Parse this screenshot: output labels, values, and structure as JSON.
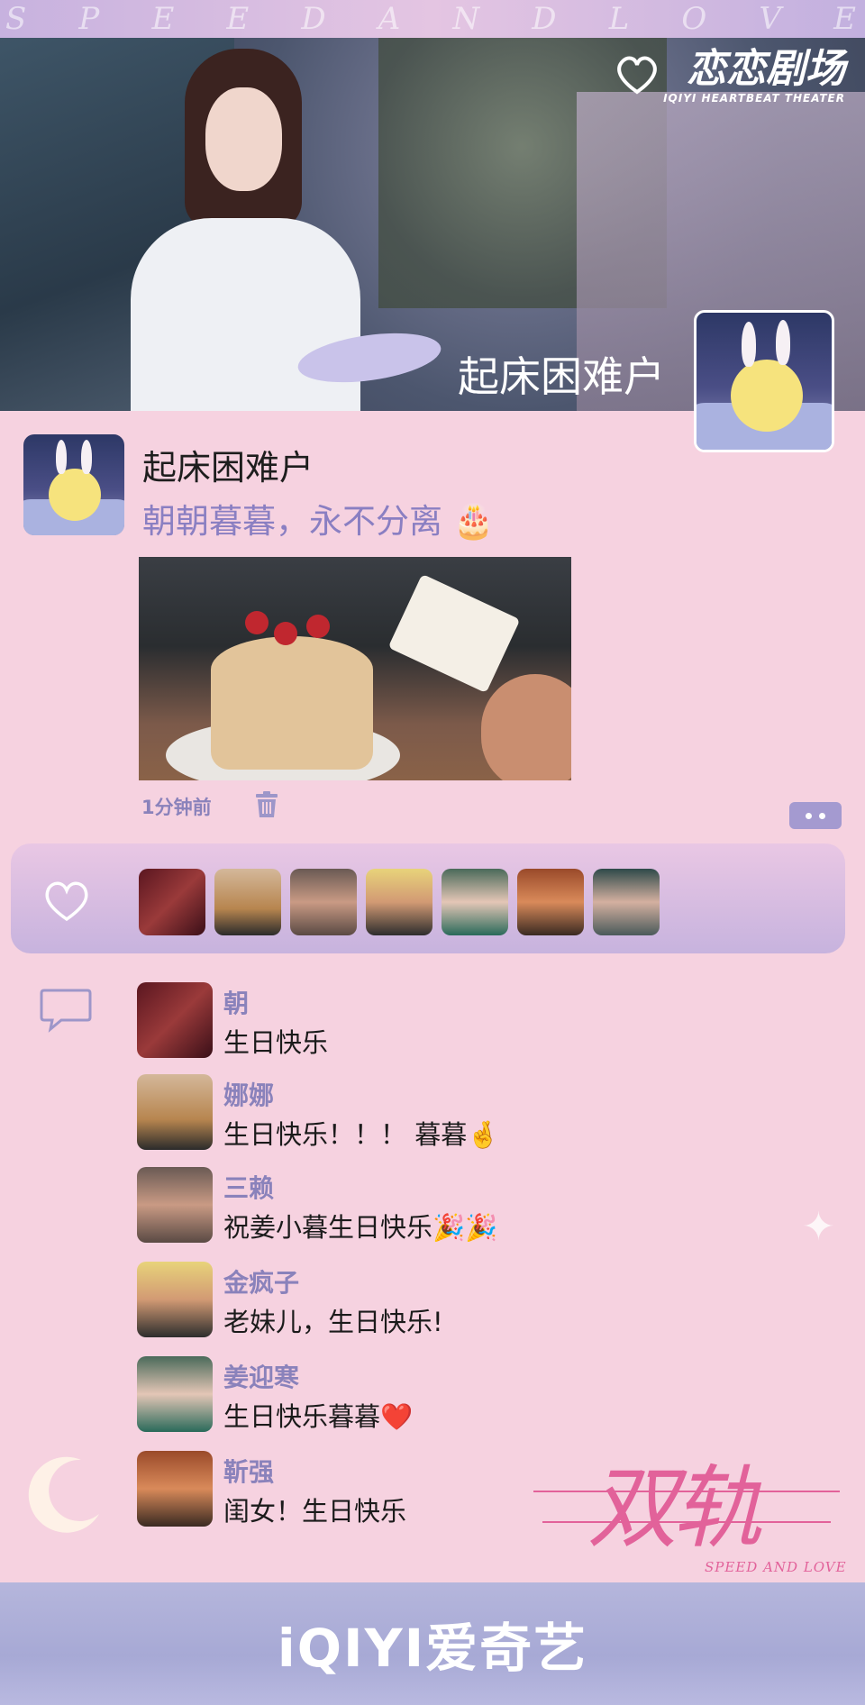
{
  "banner": {
    "letters": [
      "S",
      "P",
      "E",
      "E",
      "D",
      "A",
      "N",
      "D",
      "L",
      "O",
      "V",
      "E"
    ],
    "logo_main": "恋恋剧场",
    "logo_sub": "IQIYI HEARTBEAT THEATER",
    "hero_name": "起床困难户"
  },
  "post": {
    "author": "起床困难户",
    "text": "朝朝暮暮，永不分离 🎂",
    "time": "1分钟前"
  },
  "comments": [
    {
      "name": "朝",
      "text": "生日快乐"
    },
    {
      "name": "娜娜",
      "text": "生日快乐！！！ 暮暮🤞"
    },
    {
      "name": "三赖",
      "text": "祝姜小暮生日快乐🎉🎉"
    },
    {
      "name": "金疯子",
      "text": "老妹儿，生日快乐!"
    },
    {
      "name": "姜迎寒",
      "text": "生日快乐暮暮❤️"
    },
    {
      "name": "靳强",
      "text": "闺女！生日快乐"
    }
  ],
  "title_art": {
    "cn": "双轨",
    "en": "SPEED AND LOVE"
  },
  "footer": {
    "brand": "iQIYI爱奇艺"
  },
  "colors": {
    "background": "#f6d2e0",
    "accent_purple": "#8a82bb",
    "title_pink": "#e2629a"
  },
  "icons": [
    "heart-icon",
    "comment-icon",
    "trash-icon",
    "more-icon",
    "moon-icon",
    "star-icon"
  ]
}
